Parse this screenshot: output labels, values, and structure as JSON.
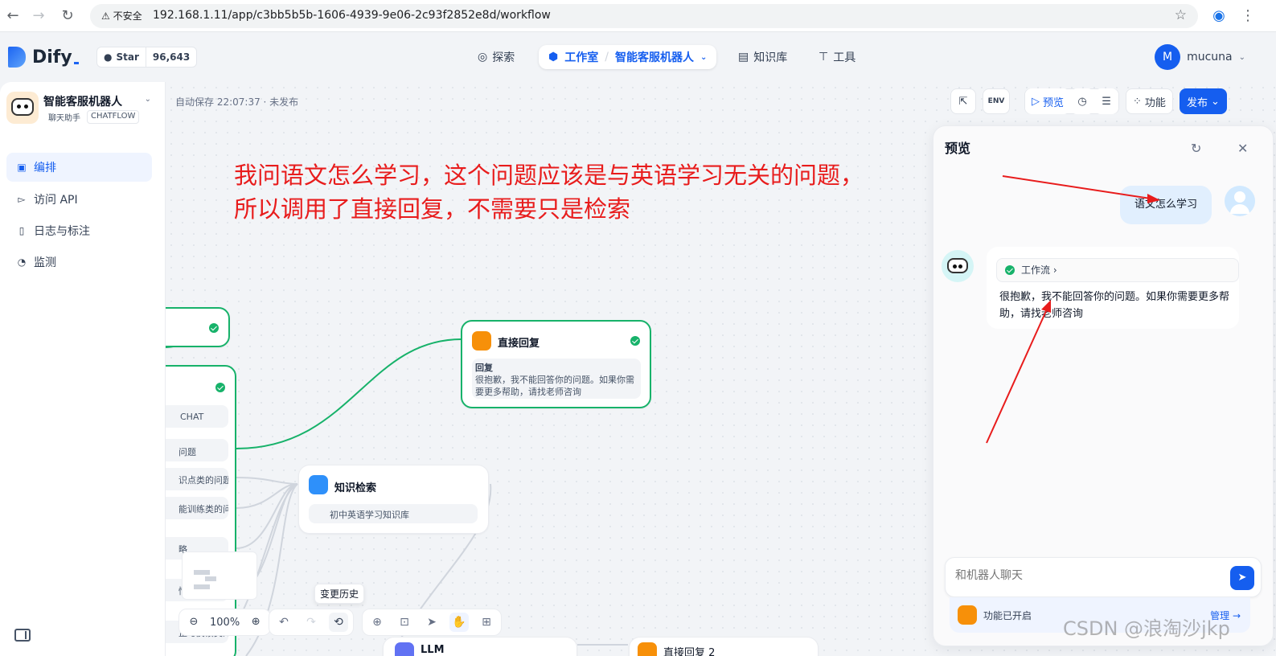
{
  "browser": {
    "insecure_label": "不安全",
    "url": "192.168.1.11/app/c3bb5b5b-1606-4939-9e06-2c93f2852e8d/workflow"
  },
  "header": {
    "logo_text": "Dify",
    "github_star_label": "Star",
    "github_star_count": "96,643",
    "nav_explore": "探索",
    "nav_studio": "工作室",
    "nav_current_app": "智能客服机器人",
    "nav_knowledge": "知识库",
    "nav_tools": "工具",
    "user_initial": "M",
    "user_name": "mucuna"
  },
  "sidebar": {
    "app_name": "智能客服机器人",
    "app_tag_type": "聊天助手",
    "app_tag_mode": "CHATFLOW",
    "items": [
      {
        "label": "编排",
        "icon": "layout-icon"
      },
      {
        "label": "访问 API",
        "icon": "terminal-icon"
      },
      {
        "label": "日志与标注",
        "icon": "file-icon"
      },
      {
        "label": "监测",
        "icon": "gauge-icon"
      }
    ]
  },
  "canvas": {
    "autosave": "自动保存 22:07:37 · 未发布",
    "annotation_line1": "我问语文怎么学习，这个问题应该是与英语学习无关的问题，",
    "annotation_line2": "所以调用了直接回复，不需要只是检索",
    "toolbar": {
      "env_label": "ENV",
      "preview_label": "预览",
      "features_label": "功能",
      "publish_label": "发布"
    },
    "nodes": {
      "direct_reply_title": "直接回复",
      "direct_reply_field": "回复",
      "direct_reply_text": "很抱歉，我不能回答你的问题。如果你需要更多帮助，请找老师咨询",
      "knowledge_title": "知识检索",
      "knowledge_base": "初中英语学习知识库",
      "classifier_chat_tag": "CHAT",
      "class_1": "问题",
      "class_2": "识点类的问题",
      "class_3": "能训练类的问",
      "class_4": "略",
      "class_5": "情",
      "class_6": "正与反馈类的",
      "llm_title": "LLM",
      "direct_reply_2_title": "直接回复 2"
    },
    "zoom": "100%",
    "tooltip_history": "变更历史"
  },
  "preview": {
    "title": "预览",
    "question": "语文怎么学习",
    "workflow_chip": "工作流",
    "answer": "很抱歉，我不能回答你的问题。如果你需要更多帮助，请找老师咨询",
    "input_placeholder": "和机器人聊天",
    "features_enabled": "功能已开启",
    "manage_label": "管理 →"
  },
  "watermark": "CSDN @浪淘沙jkp"
}
